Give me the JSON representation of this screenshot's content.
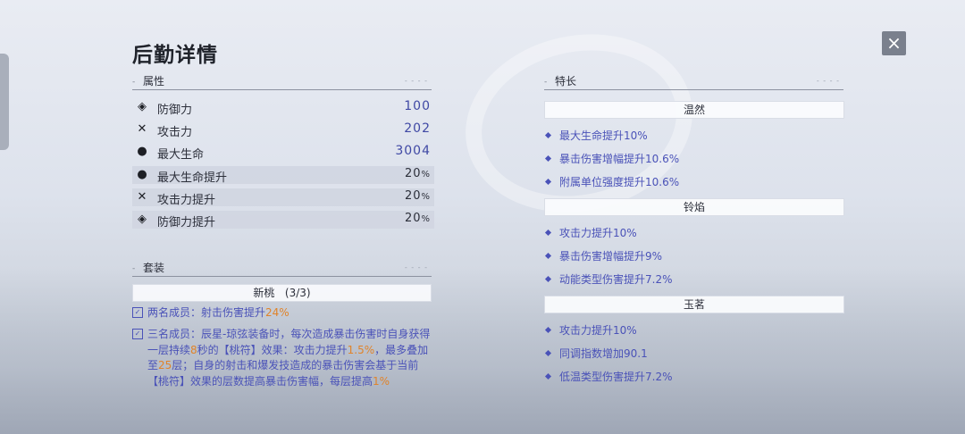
{
  "title": "后勤详情",
  "close_icon": "×",
  "attributes": {
    "header": "属性",
    "rows": [
      {
        "icon": "shield-icon",
        "glyph": "◈",
        "name": "防御力",
        "value": "100",
        "shaded": false
      },
      {
        "icon": "swords-icon",
        "glyph": "✕",
        "name": "攻击力",
        "value": "202",
        "shaded": false
      },
      {
        "icon": "drop-icon",
        "glyph": "●",
        "name": "最大生命",
        "value": "3004",
        "shaded": false
      },
      {
        "icon": "drop-icon",
        "glyph": "●",
        "name": "最大生命提升",
        "value": "20",
        "unit": "%",
        "shaded": true
      },
      {
        "icon": "swords-icon",
        "glyph": "✕",
        "name": "攻击力提升",
        "value": "20",
        "unit": "%",
        "shaded": true
      },
      {
        "icon": "shield-icon",
        "glyph": "◈",
        "name": "防御力提升",
        "value": "20",
        "unit": "%",
        "shaded": true
      }
    ]
  },
  "set": {
    "header": "套装",
    "name": "新桃",
    "count": "(3/3)",
    "two_piece": {
      "prefix": "两名成员：射击伤害提升",
      "hl": "24%"
    },
    "three_piece": [
      {
        "t": "三名成员：辰星-琼弦装备时，每次造成暴击伤害时自身获得一层持续"
      },
      {
        "t": "8",
        "hl": true
      },
      {
        "t": "秒的【桃符】效果：攻击力提升"
      },
      {
        "t": "1.5%",
        "hl": true
      },
      {
        "t": "，最多叠加至"
      },
      {
        "t": "25",
        "hl": true
      },
      {
        "t": "层；自身的射击和爆发技造成的暴击伤害会基于当前【桃符】效果的层数提高暴击伤害幅，每层提高"
      },
      {
        "t": "1%",
        "hl": true
      }
    ]
  },
  "traits": {
    "header": "特长",
    "groups": [
      {
        "name": "温然",
        "items": [
          "最大生命提升10%",
          "暴击伤害增幅提升10.6%",
          "附属单位强度提升10.6%"
        ]
      },
      {
        "name": "铃焰",
        "items": [
          "攻击力提升10%",
          "暴击伤害增幅提升9%",
          "动能类型伤害提升7.2%"
        ]
      },
      {
        "name": "玉茗",
        "items": [
          "攻击力提升10%",
          "同调指数增加90.1",
          "低温类型伤害提升7.2%"
        ]
      }
    ]
  }
}
